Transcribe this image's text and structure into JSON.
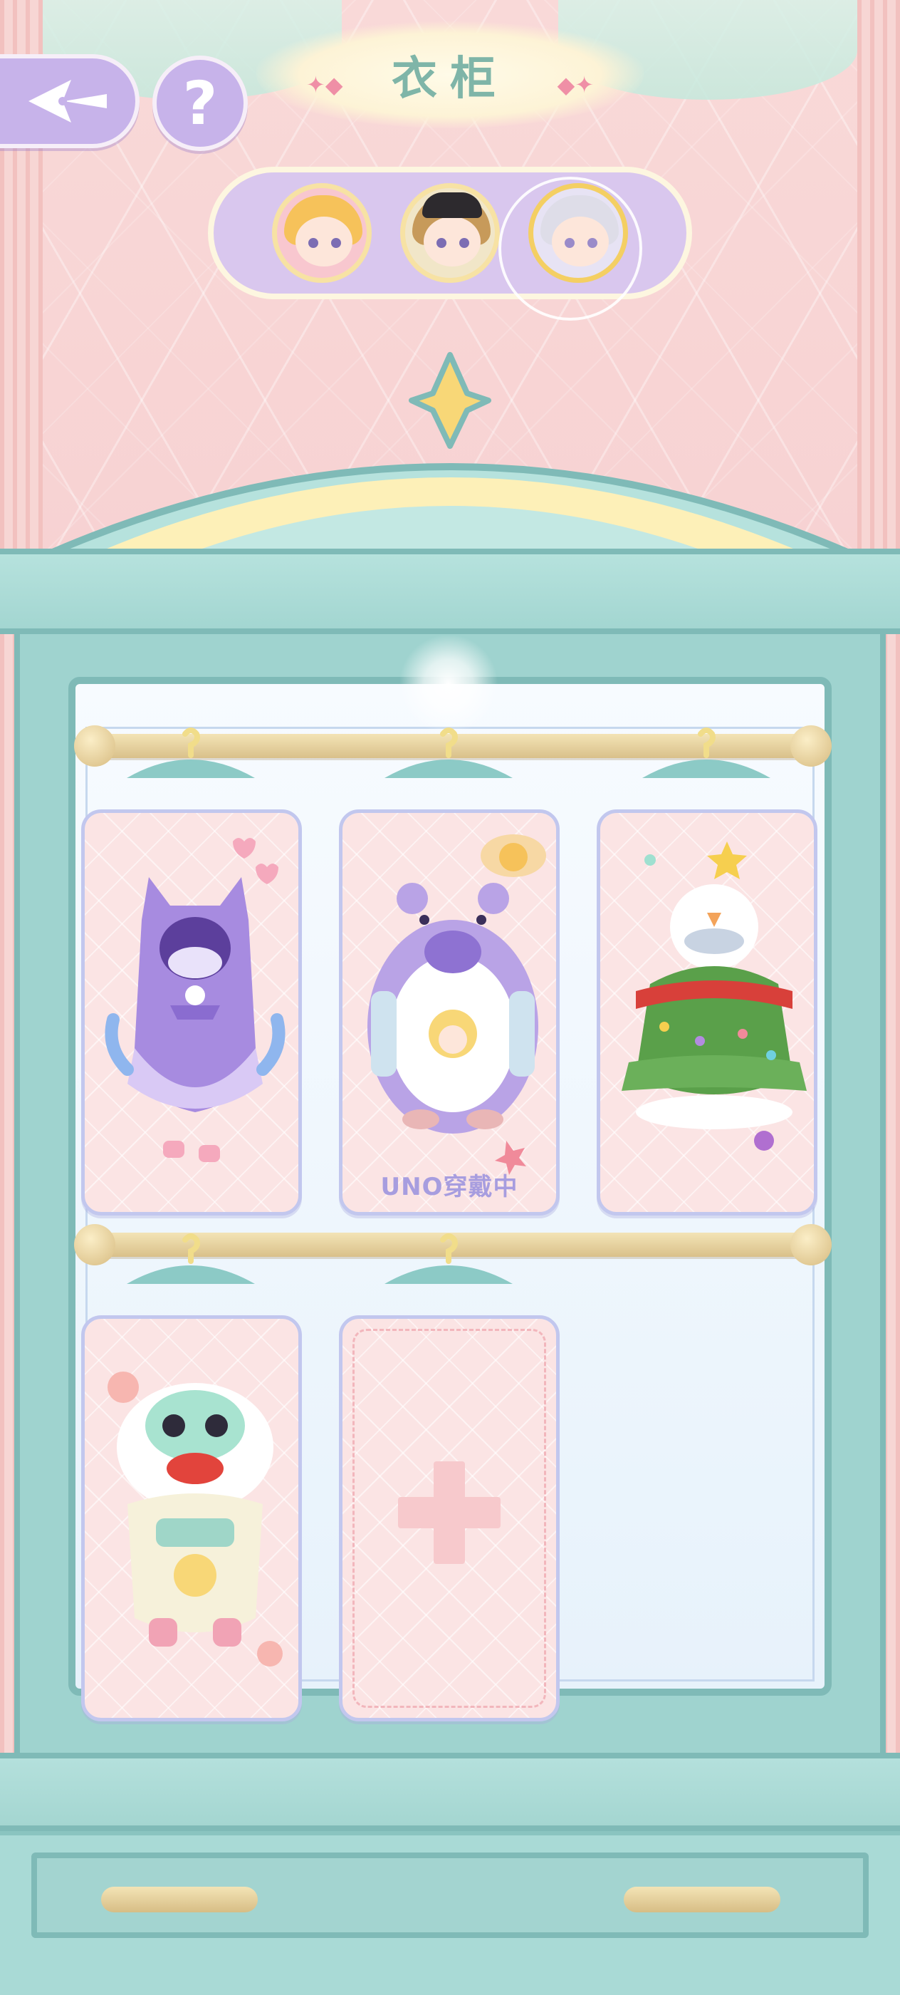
{
  "header": {
    "title": "衣柜"
  },
  "icons": {
    "back": "back-arrow-icon",
    "help": "help-icon",
    "help_glyph": "?"
  },
  "characters": [
    {
      "id": "char-1",
      "hair": "blonde",
      "selected": false
    },
    {
      "id": "char-2",
      "hair": "brown-with-black-hat",
      "selected": false
    },
    {
      "id": "char-3",
      "hair": "silver",
      "selected": true
    }
  ],
  "wardrobe": {
    "slots": [
      {
        "costume": "purple-hooded-monster-outfit",
        "wearing_label": ""
      },
      {
        "costume": "purple-hamster-outfit",
        "wearing_label": "UNO穿戴中"
      },
      {
        "costume": "christmas-tree-snowman-outfit",
        "wearing_label": ""
      },
      {
        "costume": "lion-dance-outfit",
        "wearing_label": ""
      },
      {
        "costume": "empty-add-slot",
        "wearing_label": ""
      }
    ]
  },
  "colors": {
    "accent_purple": "#c7b3ea",
    "wardrobe_teal": "#9fd3cf",
    "title_green": "#7fb5a8",
    "slot_pink": "#fbe4e4"
  }
}
